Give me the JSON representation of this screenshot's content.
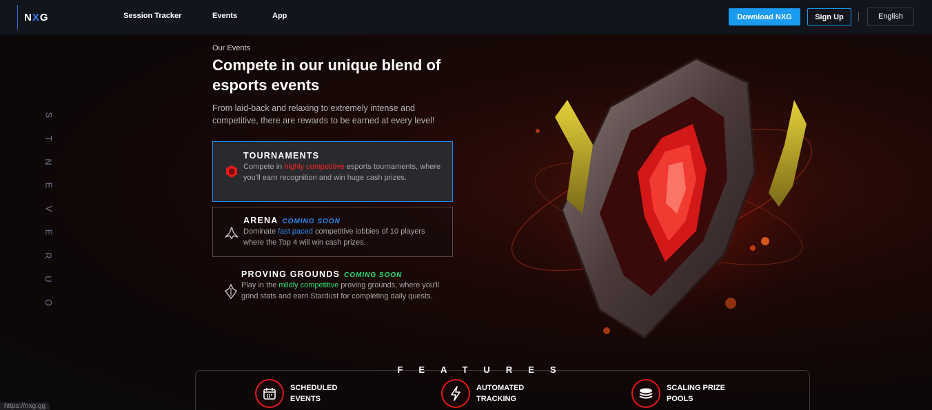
{
  "nav": {
    "logo_pre": "N",
    "logo_x": "X",
    "logo_post": "G",
    "links": [
      "Session Tracker",
      "Events",
      "App"
    ],
    "download_label": "Download NXG",
    "signup_label": "Sign Up",
    "language_label": "English"
  },
  "side_label": [
    "O",
    "U",
    "R",
    "E",
    "V",
    "E",
    "N",
    "T",
    "S"
  ],
  "hero": {
    "eyebrow": "Our Events",
    "headline": "Compete in our unique blend of esports events",
    "subtext": "From laid-back and relaxing to extremely intense and competitive, there are rewards to be earned at every level!"
  },
  "events": {
    "tournaments": {
      "title": "TOURNAMENTS",
      "desc_pre": "Compete in ",
      "desc_highlight": "highly competitive",
      "desc_post": " esports tournaments, where you'll earn recognition and win huge cash prizes.",
      "icon": "tournament-shield-icon"
    },
    "arena": {
      "title": "ARENA",
      "tag": "COMING SOON",
      "desc_pre": "Dominate ",
      "desc_highlight": "fast paced",
      "desc_post": " competitive lobbies of 10 players where the Top 4 will win cash prizes.",
      "icon": "arena-ship-icon"
    },
    "proving": {
      "title": "PROVING GROUNDS",
      "tag": "COMING SOON",
      "desc_pre": "Play in the ",
      "desc_highlight": "mildly competitive",
      "desc_post": " proving grounds, where you'll grind stats and earn Stardust for completing daily quests.",
      "icon": "proving-grounds-icon"
    }
  },
  "features": {
    "title": "FEATURES",
    "items": [
      {
        "label": "SCHEDULED EVENTS",
        "icon": "calendar-icon"
      },
      {
        "label": "AUTOMATED TRACKING",
        "icon": "lightning-icon"
      },
      {
        "label": "SCALING PRIZE POOLS",
        "icon": "coin-stack-icon"
      }
    ]
  },
  "status_url": "https://nxg.gg",
  "colors": {
    "accent_blue": "#1a9bf0",
    "highlight_red": "#f02424",
    "highlight_blue": "#2c8bf5",
    "highlight_green": "#2ee07a"
  }
}
